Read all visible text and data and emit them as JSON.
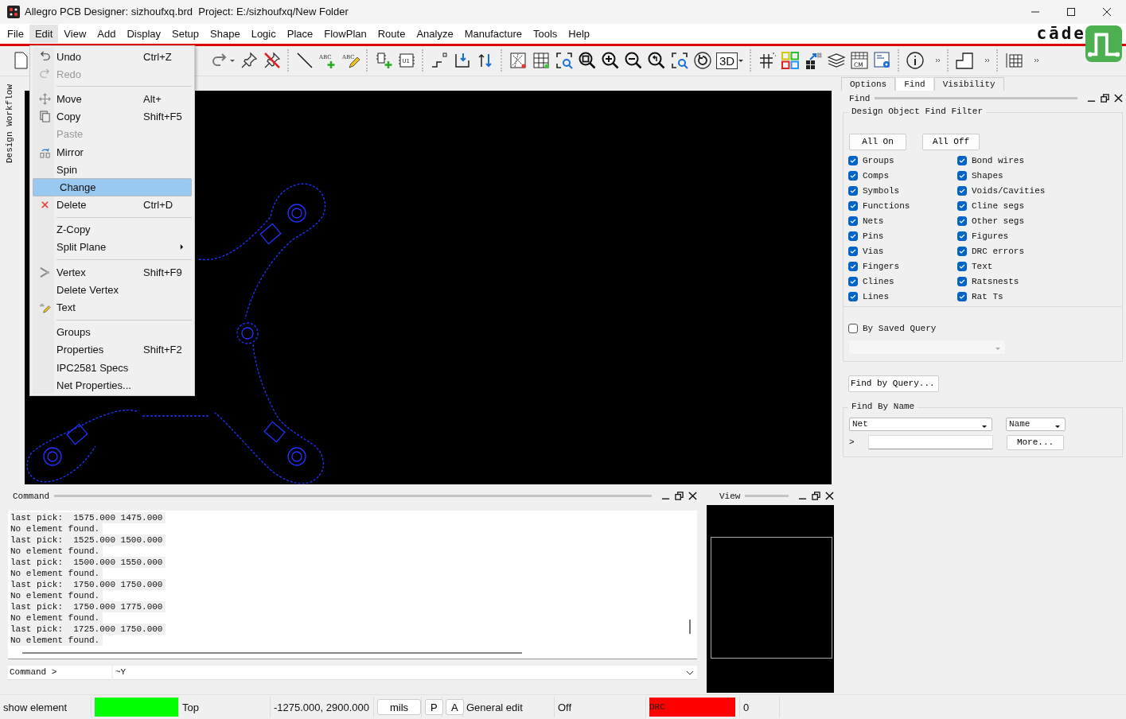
{
  "window": {
    "title": "Allegro PCB Designer: sizhoufxq.brd  Project: E:/sizhoufxq/New Folder"
  },
  "menu_bar": [
    {
      "label": "File",
      "selected": false
    },
    {
      "label": "Edit",
      "selected": true
    },
    {
      "label": "View",
      "selected": false
    },
    {
      "label": "Add",
      "selected": false
    },
    {
      "label": "Display",
      "selected": false
    },
    {
      "label": "Setup",
      "selected": false
    },
    {
      "label": "Shape",
      "selected": false
    },
    {
      "label": "Logic",
      "selected": false
    },
    {
      "label": "Place",
      "selected": false
    },
    {
      "label": "FlowPlan",
      "selected": false
    },
    {
      "label": "Route",
      "selected": false
    },
    {
      "label": "Analyze",
      "selected": false
    },
    {
      "label": "Manufacture",
      "selected": false
    },
    {
      "label": "Tools",
      "selected": false
    },
    {
      "label": "Help",
      "selected": false
    }
  ],
  "brand_logo": "cāde",
  "toolbar": {
    "icon_labels": [
      "ABC",
      "ABC",
      "U1",
      "3D",
      "CM"
    ]
  },
  "edit_menu": [
    {
      "kind": "item",
      "label": "Undo",
      "shortcut": "Ctrl+Z",
      "disabled": false,
      "selected": false
    },
    {
      "kind": "item",
      "label": "Redo",
      "disabled": true,
      "selected": false
    },
    {
      "kind": "separator"
    },
    {
      "kind": "item",
      "label": "Move",
      "shortcut": "Alt+",
      "disabled": false,
      "selected": false
    },
    {
      "kind": "item",
      "label": "Copy",
      "shortcut": "Shift+F5",
      "disabled": false,
      "selected": false
    },
    {
      "kind": "item",
      "label": "Paste",
      "disabled": true,
      "selected": false
    },
    {
      "kind": "item",
      "label": "Mirror",
      "disabled": false,
      "selected": false
    },
    {
      "kind": "item",
      "label": "Spin",
      "disabled": false,
      "selected": false
    },
    {
      "kind": "item",
      "label": "Change",
      "disabled": false,
      "selected": true
    },
    {
      "kind": "item",
      "label": "Delete",
      "shortcut": "Ctrl+D",
      "disabled": false,
      "selected": false
    },
    {
      "kind": "separator"
    },
    {
      "kind": "item",
      "label": "Z-Copy",
      "disabled": false,
      "selected": false
    },
    {
      "kind": "submenu",
      "label": "Split Plane",
      "disabled": false,
      "selected": false
    },
    {
      "kind": "separator"
    },
    {
      "kind": "item",
      "label": "Vertex",
      "shortcut": "Shift+F9",
      "disabled": false,
      "selected": false
    },
    {
      "kind": "item",
      "label": "Delete Vertex",
      "disabled": false,
      "selected": false
    },
    {
      "kind": "item",
      "label": "Text",
      "disabled": false,
      "selected": false
    },
    {
      "kind": "separator"
    },
    {
      "kind": "item",
      "label": "Groups",
      "disabled": false,
      "selected": false
    },
    {
      "kind": "item",
      "label": "Properties",
      "shortcut": "Shift+F2",
      "disabled": false,
      "selected": false
    },
    {
      "kind": "item",
      "label": "IPC2581 Specs",
      "disabled": false,
      "selected": false
    },
    {
      "kind": "item",
      "label": "Net Properties...",
      "disabled": false,
      "selected": false
    }
  ],
  "left_sidebar": {
    "label": "Design Workflow"
  },
  "panel_tabs": [
    {
      "label": "Options",
      "selected": false
    },
    {
      "label": "Find",
      "selected": true
    },
    {
      "label": "Visibility",
      "selected": false
    }
  ],
  "find_panel": {
    "title": "Find",
    "filter_group": "Design Object Find Filter",
    "all_on": "All On",
    "all_off": "All Off",
    "filters": [
      {
        "label": "Groups",
        "checked": true
      },
      {
        "label": "Comps",
        "checked": true
      },
      {
        "label": "Symbols",
        "checked": true
      },
      {
        "label": "Functions",
        "checked": true
      },
      {
        "label": "Nets",
        "checked": true
      },
      {
        "label": "Pins",
        "checked": true
      },
      {
        "label": "Vias",
        "checked": true
      },
      {
        "label": "Fingers",
        "checked": true
      },
      {
        "label": "Clines",
        "checked": true
      },
      {
        "label": "Lines",
        "checked": true
      },
      {
        "label": "Bond wires",
        "checked": true
      },
      {
        "label": "Shapes",
        "checked": true
      },
      {
        "label": "Voids/Cavities",
        "checked": true
      },
      {
        "label": "Cline segs",
        "checked": true
      },
      {
        "label": "Other segs",
        "checked": true
      },
      {
        "label": "Figures",
        "checked": true
      },
      {
        "label": "DRC errors",
        "checked": true
      },
      {
        "label": "Text",
        "checked": true
      },
      {
        "label": "Ratsnests",
        "checked": true
      },
      {
        "label": "Rat Ts",
        "checked": true
      }
    ],
    "saved_query": {
      "label": "By Saved Query",
      "checked": false
    },
    "find_by_query": "Find by Query...",
    "find_by_name": {
      "title": "Find By Name",
      "object_type": "Net",
      "match": "Name",
      "prompt": ">",
      "more": "More..."
    }
  },
  "command_panel": {
    "title": "Command",
    "log": [
      "last pick:  1575.000 1475.000",
      "No element found.",
      "last pick:  1525.000 1500.000",
      "No element found.",
      "last pick:  1500.000 1550.000",
      "No element found.",
      "last pick:  1750.000 1750.000",
      "No element found.",
      "last pick:  1750.000 1775.000",
      "No element found.",
      "last pick:  1725.000 1750.000",
      "No element found."
    ],
    "prompt": "Command >",
    "input": "~Y"
  },
  "view_panel": {
    "title": "View"
  },
  "status_bar": [
    {
      "kind": "text",
      "text": "show element"
    },
    {
      "kind": "color",
      "color": "#00ff00"
    },
    {
      "kind": "text",
      "text": "Top"
    },
    {
      "kind": "text",
      "text": "-1275.000, 2900.000"
    },
    {
      "kind": "button",
      "text": "mils"
    },
    {
      "kind": "button",
      "text": "P"
    },
    {
      "kind": "button",
      "text": "A"
    },
    {
      "kind": "text",
      "text": "General edit"
    },
    {
      "kind": "text",
      "text": "Off"
    },
    {
      "kind": "color",
      "color": "#ff0000",
      "text": "DRC"
    },
    {
      "kind": "text",
      "text": "0"
    }
  ]
}
